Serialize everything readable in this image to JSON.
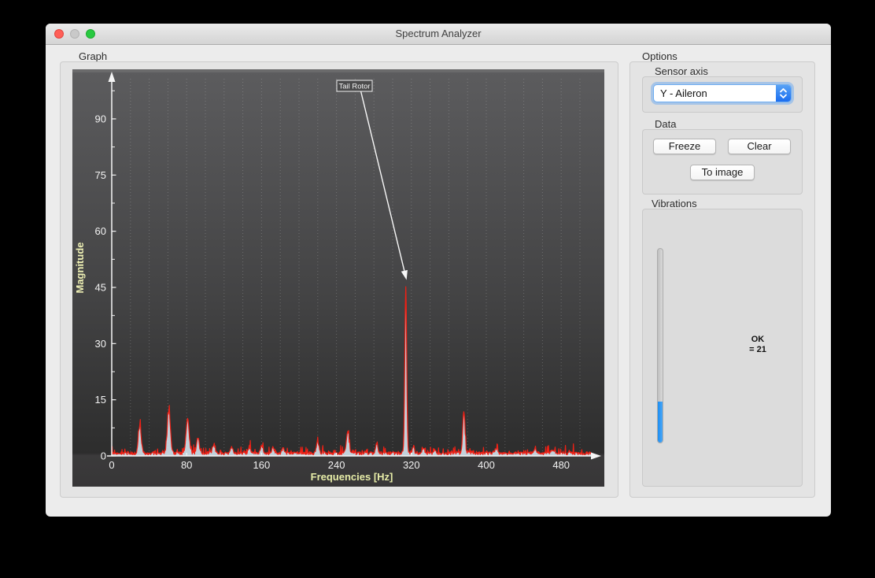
{
  "window": {
    "title": "Spectrum Analyzer"
  },
  "graph": {
    "group_label": "Graph"
  },
  "options": {
    "group_label": "Options",
    "sensor_axis": {
      "group_label": "Sensor axis",
      "selected_value": "Y - Aileron"
    },
    "data": {
      "group_label": "Data",
      "freeze_label": "Freeze",
      "clear_label": "Clear",
      "to_image_label": "To image"
    },
    "vibrations": {
      "group_label": "Vibrations",
      "status": "OK",
      "value_label": "= 21",
      "level_percent": 21
    }
  },
  "chart_data": {
    "type": "line",
    "title": "",
    "xlabel": "Frequencies [Hz]",
    "ylabel": "Magnitude",
    "xlim": [
      0,
      520
    ],
    "ylim": [
      0,
      100
    ],
    "x_ticks": [
      0,
      80,
      160,
      240,
      320,
      400,
      480
    ],
    "y_ticks": [
      0,
      15,
      30,
      45,
      60,
      75,
      90
    ],
    "grid": "vertical-dotted-every-20Hz",
    "legend": "none",
    "trace_color": "#ee2015",
    "fill_color": "#d7e8f3",
    "noise_floor": [
      0.3,
      1.4
    ],
    "x_end": 512,
    "series": [
      {
        "name": "vibration-spectrum",
        "peaks": [
          {
            "freq": 30,
            "mag": 7.3,
            "w": 1.5
          },
          {
            "freq": 61,
            "mag": 11.3,
            "w": 1.6
          },
          {
            "freq": 81,
            "mag": 9.3,
            "w": 1.6
          },
          {
            "freq": 92,
            "mag": 4.1,
            "w": 1.4
          },
          {
            "freq": 109,
            "mag": 2.5,
            "w": 1.3
          },
          {
            "freq": 128,
            "mag": 1.6,
            "w": 1.3
          },
          {
            "freq": 147,
            "mag": 1.7,
            "w": 1.2
          },
          {
            "freq": 160,
            "mag": 2.0,
            "w": 1.2
          },
          {
            "freq": 172,
            "mag": 1.6,
            "w": 1.2
          },
          {
            "freq": 183,
            "mag": 1.3,
            "w": 1.2
          },
          {
            "freq": 220,
            "mag": 3.2,
            "w": 1.3
          },
          {
            "freq": 252,
            "mag": 5.6,
            "w": 1.4
          },
          {
            "freq": 283,
            "mag": 2.4,
            "w": 1.2
          },
          {
            "freq": 314,
            "mag": 44.5,
            "w": 1.0
          },
          {
            "freq": 322,
            "mag": 1.8,
            "w": 1.1
          },
          {
            "freq": 333,
            "mag": 1.5,
            "w": 1.1
          },
          {
            "freq": 345,
            "mag": 1.2,
            "w": 1.1
          },
          {
            "freq": 376,
            "mag": 10.9,
            "w": 1.2
          },
          {
            "freq": 410,
            "mag": 1.1,
            "w": 1.1
          },
          {
            "freq": 452,
            "mag": 1.0,
            "w": 1.1
          },
          {
            "freq": 470,
            "mag": 1.2,
            "w": 1.1
          }
        ]
      }
    ],
    "annotation": {
      "text": "Tail Rotor",
      "points_to_freq": 314,
      "points_to_mag": 47
    }
  }
}
